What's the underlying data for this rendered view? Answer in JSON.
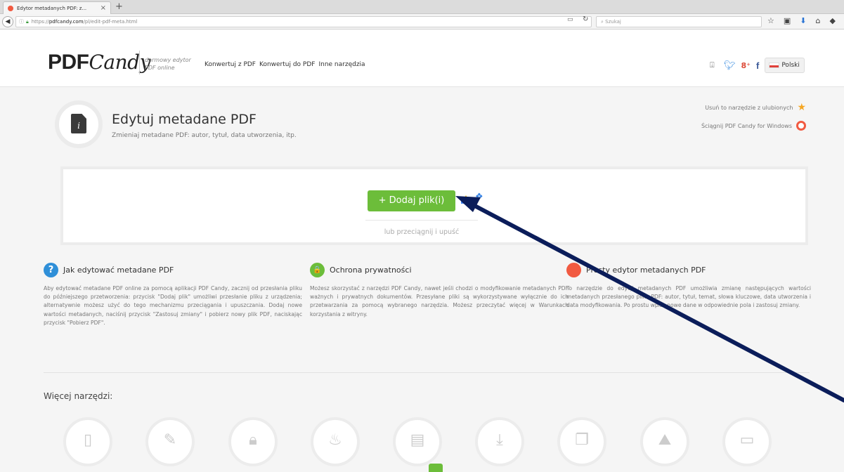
{
  "browser": {
    "tab_title": "Edytor metadanych PDF: z...",
    "tab_close": "×",
    "new_tab": "+",
    "back": "◀",
    "url_scheme": "https://",
    "url_host": "pdfcandy.com",
    "url_path": "/pl/edit-pdf-meta.html",
    "search_placeholder": "Szukaj"
  },
  "header": {
    "logo_pdf": "PDF",
    "logo_candy": "Candy",
    "tagline_line1": "darmowy edytor",
    "tagline_line2": "PDF online",
    "nav": [
      "Konwertuj z PDF",
      "Konwertuj do PDF",
      "Inne narzędzia"
    ],
    "language": "Polski"
  },
  "tool": {
    "title": "Edytuj metadane PDF",
    "subtitle": "Zmieniaj metadane PDF: autor, tytuł, data utworzenia, itp.",
    "favorite_link": "Usuń to narzędzie z ulubionych",
    "windows_link": "Ściągnij PDF Candy for Windows"
  },
  "upload": {
    "button_label": "+ Dodaj plik(i)",
    "drop_hint": "lub przeciągnij i upuść"
  },
  "info": [
    {
      "icon": "?",
      "title": "Jak edytować metadane PDF",
      "text": "Aby edytować metadane PDF online za pomocą aplikacji PDF Candy, zacznij od przesłania pliku do późniejszego przetworzenia: przycisk \"Dodaj plik\" umożliwi przesłanie pliku z urządzenia; alternatywnie możesz użyć do tego mechanizmu przeciągania i upuszczania. Dodaj nowe wartości metadanych, naciśnij przycisk \"Zastosuj zmiany\" i pobierz nowy plik PDF, naciskając przycisk \"Pobierz PDF\"."
    },
    {
      "icon": "🔒",
      "title": "Ochrona prywatności",
      "text": "Możesz skorzystać z narzędzi PDF Candy, nawet jeśli chodzi o modyfikowanie metadanych PDF ważnych i prywatnych dokumentów. Przesyłane pliki są wykorzystywane wyłącznie do ich przetwarzania za pomocą wybranego narzędzia. Możesz przeczytać więcej w Warunkach korzystania z witryny."
    },
    {
      "icon": "",
      "title": "Prosty edytor metadanych PDF",
      "text": "To narzędzie do edycji metadanych PDF umożliwia zmianę następujących wartości metadanych przesłanego pliku PDF: autor, tytuł, temat, słowa kluczowe, data utworzenia i data modyfikowania. Po prostu wpisz nowe dane w odpowiednie pola i zastosuj zmiany."
    }
  ],
  "more_tools": {
    "title": "Więcej narzędzi:",
    "icons": [
      "tablet-icon",
      "edit-file-icon",
      "padlock-icon",
      "flame-icon",
      "word-file-icon",
      "download-tray-icon",
      "copy-file-icon",
      "image-download-icon",
      "photo-frame-icon"
    ]
  },
  "colors": {
    "accent_green": "#6cbd3a",
    "link_blue": "#2f8fd8",
    "brand_red": "#f15a41",
    "arrow_navy": "#0b1d5a"
  }
}
